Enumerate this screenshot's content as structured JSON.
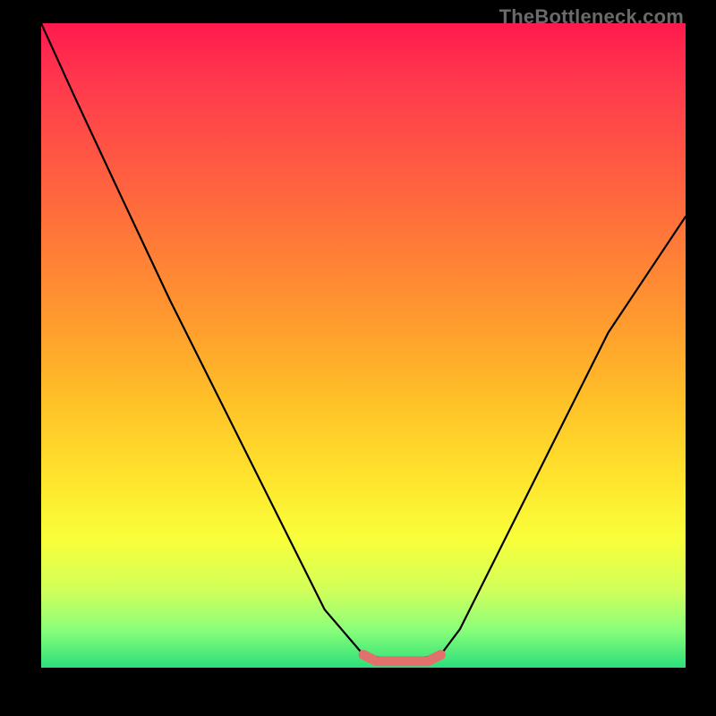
{
  "watermark": "TheBottleneck.com",
  "chart_data": {
    "type": "line",
    "title": "",
    "xlabel": "",
    "ylabel": "",
    "xlim": [
      0,
      100
    ],
    "ylim": [
      0,
      100
    ],
    "grid": false,
    "series": [
      {
        "name": "bottleneck-curve",
        "color": "#000000",
        "x": [
          0,
          5,
          12,
          20,
          28,
          36,
          44,
          50,
          53,
          56,
          59,
          62,
          65,
          72,
          80,
          88,
          96,
          100
        ],
        "values": [
          100,
          89,
          74,
          57,
          41,
          25,
          9,
          2,
          1.5,
          1.5,
          1.5,
          2,
          6,
          20,
          36,
          52,
          64,
          70
        ]
      },
      {
        "name": "optimal-marker",
        "color": "#e0716c",
        "x": [
          50,
          52,
          54,
          56,
          58,
          60,
          62
        ],
        "values": [
          2,
          1,
          1,
          1,
          1,
          1,
          2
        ]
      }
    ],
    "gradient_stops": [
      {
        "pos": 0,
        "color": "#ff1a4d"
      },
      {
        "pos": 10,
        "color": "#ff3b4d"
      },
      {
        "pos": 22,
        "color": "#ff5a42"
      },
      {
        "pos": 34,
        "color": "#ff7a38"
      },
      {
        "pos": 46,
        "color": "#ff9a2e"
      },
      {
        "pos": 58,
        "color": "#ffbf28"
      },
      {
        "pos": 70,
        "color": "#ffe22c"
      },
      {
        "pos": 80,
        "color": "#f9ff3a"
      },
      {
        "pos": 88,
        "color": "#d1ff5a"
      },
      {
        "pos": 94,
        "color": "#8cff7a"
      },
      {
        "pos": 100,
        "color": "#2be07a"
      }
    ]
  }
}
